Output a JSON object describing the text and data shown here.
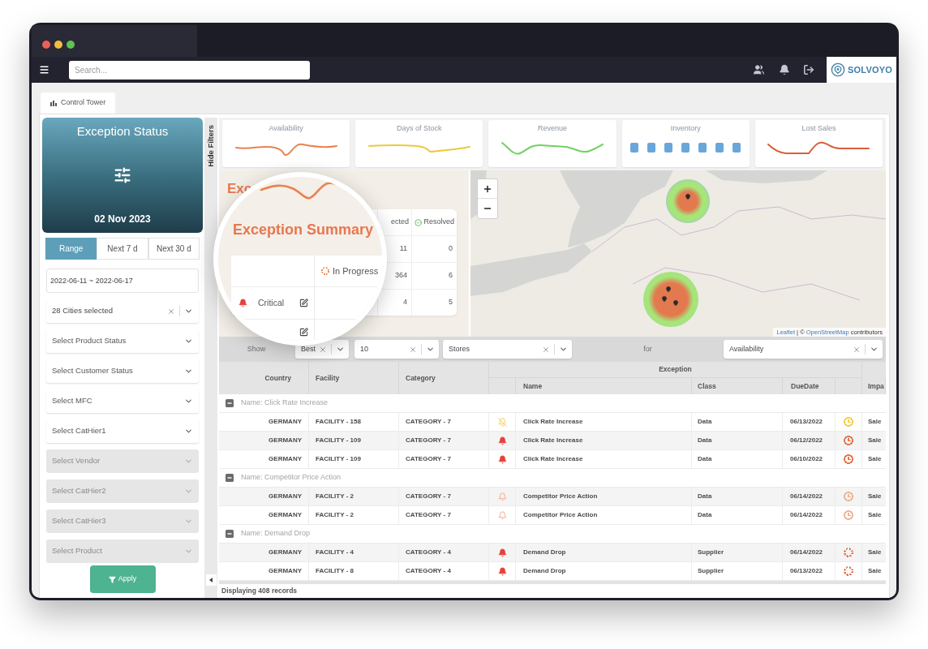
{
  "window": {
    "controls": [
      {
        "color": "#ec5f57"
      },
      {
        "color": "#f2bd3f"
      },
      {
        "color": "#5fc452"
      }
    ]
  },
  "topbar": {
    "search": {
      "placeholder": "Search..."
    },
    "icons": [
      {
        "kind": "users"
      },
      {
        "kind": "bell"
      },
      {
        "kind": "logout"
      }
    ],
    "logo": {
      "text": "SOLVOYO"
    }
  },
  "tabs": [
    {
      "label": "Control Tower",
      "selected": true
    }
  ],
  "sidebar": {
    "status_card": {
      "title": "Exception Status",
      "date": "02 Nov 2023"
    },
    "ranges": [
      {
        "label": "Range",
        "selected": true
      },
      {
        "label": "Next 7 d",
        "selected": false
      },
      {
        "label": "Next 30 d",
        "selected": false
      }
    ],
    "filters": [
      {
        "kind": "date-range",
        "value": "2022-06-11 ~ 2022-06-17"
      },
      {
        "kind": "select",
        "value": "28 Cities selected",
        "clearable": true,
        "disabled": false
      },
      {
        "kind": "select",
        "placeholder": "Select Product Status",
        "clearable": false,
        "disabled": false
      },
      {
        "kind": "select",
        "placeholder": "Select Customer Status",
        "clearable": false,
        "disabled": false
      },
      {
        "kind": "select",
        "placeholder": "Select MFC",
        "clearable": false,
        "disabled": false
      },
      {
        "kind": "select",
        "placeholder": "Select CatHier1",
        "clearable": false,
        "disabled": false
      },
      {
        "kind": "select",
        "placeholder": "Select Vendor",
        "clearable": false,
        "disabled": true
      },
      {
        "kind": "select",
        "placeholder": "Select CatHier2",
        "clearable": false,
        "disabled": true
      },
      {
        "kind": "select",
        "placeholder": "Select CatHier3",
        "clearable": false,
        "disabled": true
      },
      {
        "kind": "select",
        "placeholder": "Select Product",
        "clearable": false,
        "disabled": true
      }
    ],
    "apply": {
      "label": "Apply"
    }
  },
  "hide_filters": {
    "label": "Hide Filters"
  },
  "kpis": [
    {
      "title": "Availability",
      "kind": "line",
      "color": "#e8834f"
    },
    {
      "title": "Days of Stock",
      "kind": "line",
      "color": "#ebc93c"
    },
    {
      "title": "Revenue",
      "kind": "line",
      "color": "#72d062"
    },
    {
      "title": "Inventory",
      "kind": "bars",
      "color": "#6aa6da"
    },
    {
      "title": "Lost Sales",
      "kind": "line",
      "color": "#d9603b"
    }
  ],
  "summary": {
    "title": "Exc",
    "columns": [
      {
        "kind": "plain",
        "label": "ected"
      },
      {
        "kind": "resolved",
        "label": "Resolved"
      }
    ],
    "rows": [
      [
        "11",
        "0"
      ],
      [
        "364",
        "6"
      ],
      [
        "4",
        "5"
      ]
    ]
  },
  "magnifier": {
    "title": "Exception Summary",
    "column": {
      "kind": "in-progress",
      "label": "In Progress"
    },
    "rows": [
      {
        "kind": "critical",
        "label": "Critical"
      },
      {
        "kind": "partial"
      }
    ]
  },
  "map": {
    "attribution": [
      {
        "kind": "link",
        "text": "Leaflet"
      },
      {
        "kind": "text",
        "text": "| ©"
      },
      {
        "kind": "link",
        "text": "OpenStreetMap"
      },
      {
        "kind": "text",
        "text": "contributors"
      }
    ]
  },
  "toolbar": [
    {
      "kind": "label",
      "text": "Show"
    },
    {
      "kind": "select",
      "value": "Best",
      "clearable": true
    },
    {
      "kind": "select",
      "value": "10",
      "clearable": true
    },
    {
      "kind": "select",
      "value": "Stores",
      "clearable": true
    },
    {
      "kind": "label",
      "text": "for"
    },
    {
      "kind": "select",
      "value": "Availability",
      "clearable": true
    }
  ],
  "table": {
    "column_group": "Exception",
    "columns": [
      "Country",
      "Facility",
      "Category",
      "Name",
      "Class",
      "DueDate",
      "Impa"
    ],
    "groups": [
      {
        "label": "Name: Click Rate Increase",
        "expanded": true,
        "rows": [
          {
            "country": "GERMANY",
            "facility": "FACILITY - 158",
            "category": "CATEGORY - 7",
            "alert": {
              "kind": "muted"
            },
            "name": "Click Rate Increase",
            "class": "Data",
            "due_date": "06/13/2022",
            "due_icon": {
              "kind": "clock",
              "color": "#f2cf52"
            },
            "impact": "Sale"
          },
          {
            "country": "GERMANY",
            "facility": "FACILITY - 109",
            "category": "CATEGORY - 7",
            "alert": {
              "kind": "critical"
            },
            "name": "Click Rate Increase",
            "class": "Data",
            "due_date": "06/12/2022",
            "due_icon": {
              "kind": "clock",
              "color": "#e8744d"
            },
            "impact": "Sale"
          },
          {
            "country": "GERMANY",
            "facility": "FACILITY - 109",
            "category": "CATEGORY - 7",
            "alert": {
              "kind": "critical"
            },
            "name": "Click Rate Increase",
            "class": "Data",
            "due_date": "06/10/2022",
            "due_icon": {
              "kind": "clock",
              "color": "#e8744d"
            },
            "impact": "Sale"
          }
        ]
      },
      {
        "label": "Name: Competitor Price Action",
        "expanded": true,
        "rows": [
          {
            "country": "GERMANY",
            "facility": "FACILITY - 2",
            "category": "CATEGORY - 7",
            "alert": {
              "kind": "warning"
            },
            "name": "Competitor Price Action",
            "class": "Data",
            "due_date": "06/14/2022",
            "due_icon": {
              "kind": "clock",
              "color": "#f0b393"
            },
            "impact": "Sale"
          },
          {
            "country": "GERMANY",
            "facility": "FACILITY - 2",
            "category": "CATEGORY - 7",
            "alert": {
              "kind": "warning"
            },
            "name": "Competitor Price Action",
            "class": "Data",
            "due_date": "06/14/2022",
            "due_icon": {
              "kind": "clock",
              "color": "#f0b393"
            },
            "impact": "Sale"
          }
        ]
      },
      {
        "label": "Name: Demand Drop",
        "expanded": true,
        "rows": [
          {
            "country": "GERMANY",
            "facility": "FACILITY - 4",
            "category": "CATEGORY - 4",
            "alert": {
              "kind": "critical"
            },
            "name": "Demand Drop",
            "class": "Supplier",
            "due_date": "06/14/2022",
            "due_icon": {
              "kind": "spinner",
              "color": "#e8744d"
            },
            "impact": "Sale"
          },
          {
            "country": "GERMANY",
            "facility": "FACILITY - 8",
            "category": "CATEGORY - 4",
            "alert": {
              "kind": "critical"
            },
            "name": "Demand Drop",
            "class": "Supplier",
            "due_date": "06/13/2022",
            "due_icon": {
              "kind": "spinner",
              "color": "#e8744d"
            },
            "impact": "Sale"
          }
        ]
      }
    ]
  },
  "footer": {
    "text": "Displaying 408 records"
  }
}
